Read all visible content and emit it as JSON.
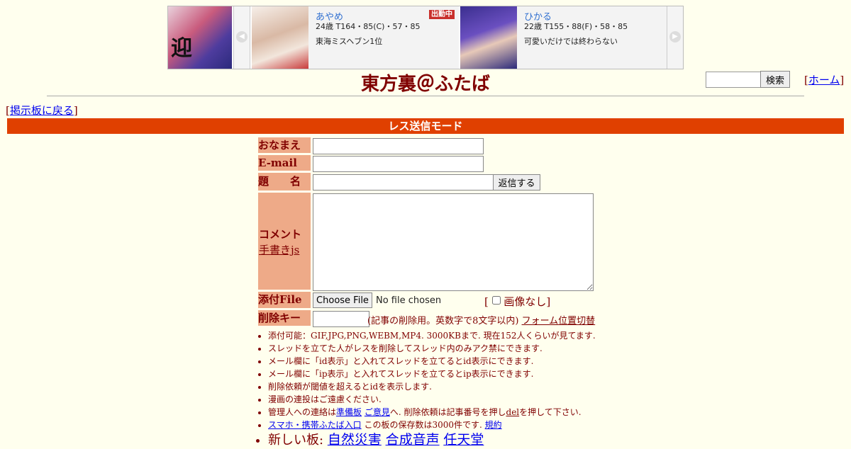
{
  "banner": {
    "cards": [
      {
        "name": "あやめ",
        "spec": "24歳 T164・85(C)・57・85",
        "desc": "東海ミスヘブン1位",
        "badge": "出勤中"
      },
      {
        "name": "ひかる",
        "spec": "22歳 T155・88(F)・58・85",
        "desc": "可愛いだけでは終わらない",
        "badge": ""
      }
    ]
  },
  "header": {
    "title": "東方裏＠ふたば",
    "search_button": "検索",
    "home_link": "ホーム"
  },
  "nav": {
    "back_link": "掲示板に戻る"
  },
  "mode_bar": "レス送信モード",
  "form": {
    "name_label": "おなまえ",
    "email_label": "E-mail",
    "subject_label": "題　　名",
    "submit_button": "返信する",
    "comment_label": "コメント",
    "handwrite_link": "手書きjs",
    "file_label": "添付File",
    "choose_file_button": "Choose File",
    "no_file_text": "No file chosen",
    "no_image_label": "画像なし",
    "delkey_label": "削除キー",
    "delkey_note": "(記事の削除用。英数字で8文字以内)",
    "form_toggle_link": "フォーム位置切替"
  },
  "rules": [
    "添付可能：GIF,JPG,PNG,WEBM,MP4. 3000KBまで. 現在152人くらいが見てます.",
    "スレッドを立てた人がレスを削除してスレッド内のみアク禁にできます.",
    "メール欄に「id表示」と入れてスレッドを立てるとid表示にできます.",
    "メール欄に「ip表示」と入れてスレッドを立てるとip表示にできます.",
    "削除依頼が閾値を超えるとidを表示します.",
    "漫画の連投はご遠慮ください."
  ],
  "contact": {
    "prefix": "管理人への連絡は",
    "link1": "準備板",
    "link2": "ご意見",
    "middle": "へ. 削除依頼は記事番号を押し",
    "del_link": "del",
    "suffix": "を押して下さい."
  },
  "mobile": {
    "link": "スマホ・携帯ふたば入口",
    "text": "この板の保存数は3000件です.",
    "rules_link": "規約"
  },
  "new_boards": {
    "label": "新しい板:",
    "links": [
      "自然災害",
      "合成音声",
      "任天堂"
    ]
  }
}
